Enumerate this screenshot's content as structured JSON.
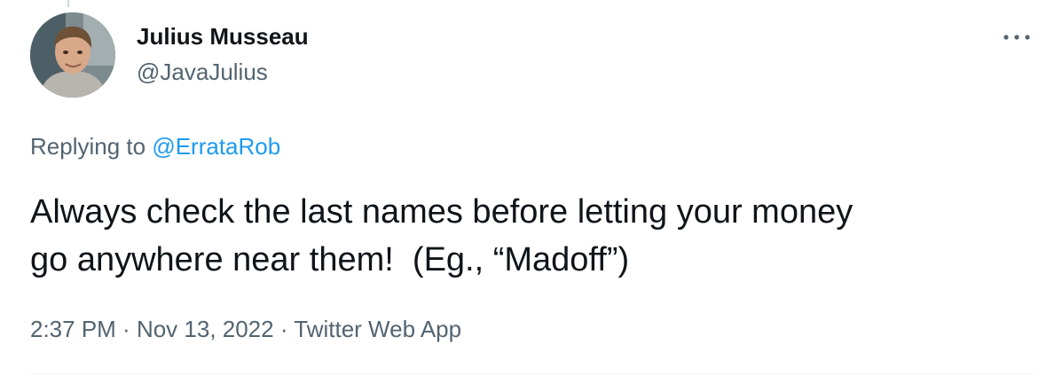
{
  "tweet": {
    "author": {
      "display_name": "Julius Musseau",
      "handle": "@JavaJulius",
      "avatar_icon": "profile-photo"
    },
    "more_icon": "more-horizontal-icon",
    "reply": {
      "prefix": "Replying to ",
      "target": "@ErrataRob"
    },
    "text": "Always check the last names before letting your money\ngo anywhere near them!  (Eg., “Madoff”)",
    "meta": {
      "time": "2:37 PM",
      "separator_1": " · ",
      "date": "Nov 13, 2022",
      "separator_2": " · ",
      "source": "Twitter Web App"
    }
  },
  "colors": {
    "text_primary": "#0f1419",
    "text_secondary": "#536471",
    "link": "#1d9bf0",
    "divider": "#eff3f4"
  }
}
